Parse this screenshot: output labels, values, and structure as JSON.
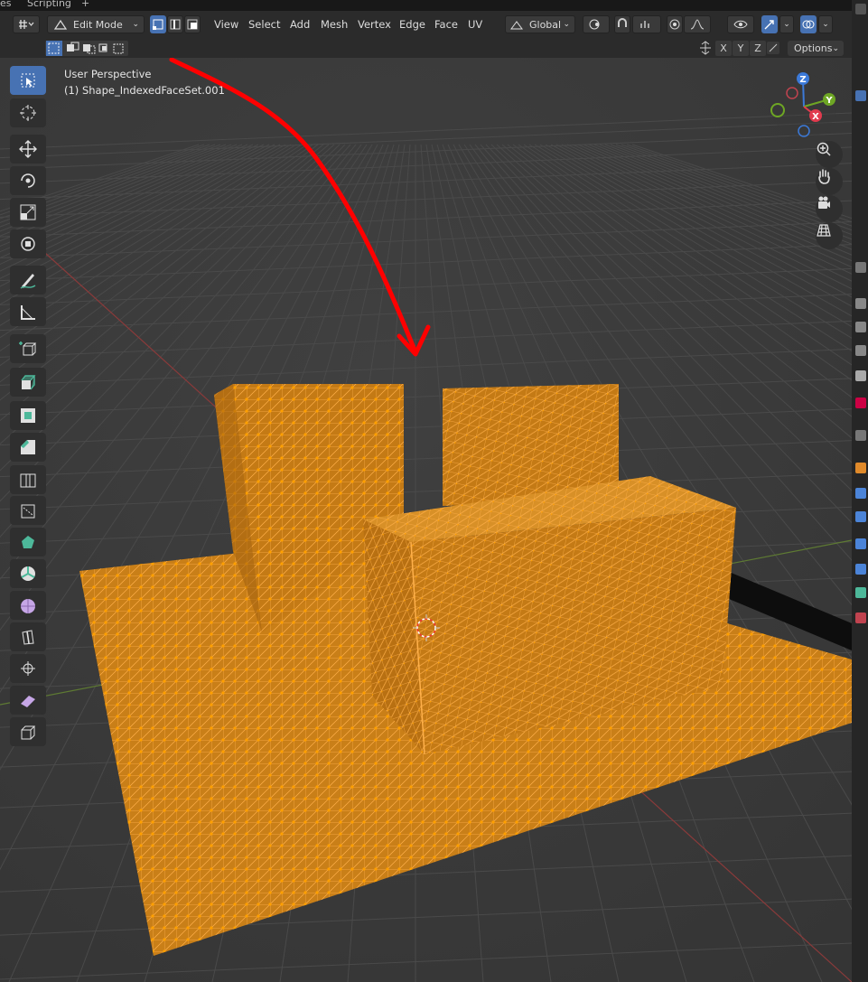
{
  "tabs": {
    "partial_left": "es",
    "scripting": "Scripting",
    "add": "+"
  },
  "header": {
    "mode": "Edit Mode",
    "menu": [
      "View",
      "Select",
      "Add",
      "Mesh",
      "Vertex",
      "Edge",
      "Face",
      "UV"
    ],
    "transform_orientation": "Global",
    "select_modes": [
      "vertex-select-icon",
      "edge-select-icon",
      "face-select-icon"
    ]
  },
  "subheader": {
    "axes": [
      "X",
      "Y",
      "Z"
    ],
    "options": "Options"
  },
  "viewport": {
    "perspective": "User Perspective",
    "object": "(1) Shape_IndexedFaceSet.001",
    "gizmo_axes": [
      "Z",
      "Y",
      "X"
    ]
  },
  "toolbar": [
    "select-box-icon",
    "cursor-icon",
    "move-icon",
    "rotate-icon",
    "scale-icon",
    "transform-icon",
    "annotate-icon",
    "measure-icon",
    "add-cube-icon",
    "extrude-icon",
    "inset-icon",
    "bevel-icon",
    "loop-cut-icon",
    "knife-icon",
    "poly-build-icon",
    "spin-icon",
    "smooth-icon",
    "edge-slide-icon",
    "shrink-fatten-icon",
    "shear-icon",
    "rip-icon"
  ],
  "colors": {
    "mesh": "#d58a1c",
    "wire": "#ffa63a",
    "accent": "#4772b3",
    "annotation": "#ff0000"
  }
}
